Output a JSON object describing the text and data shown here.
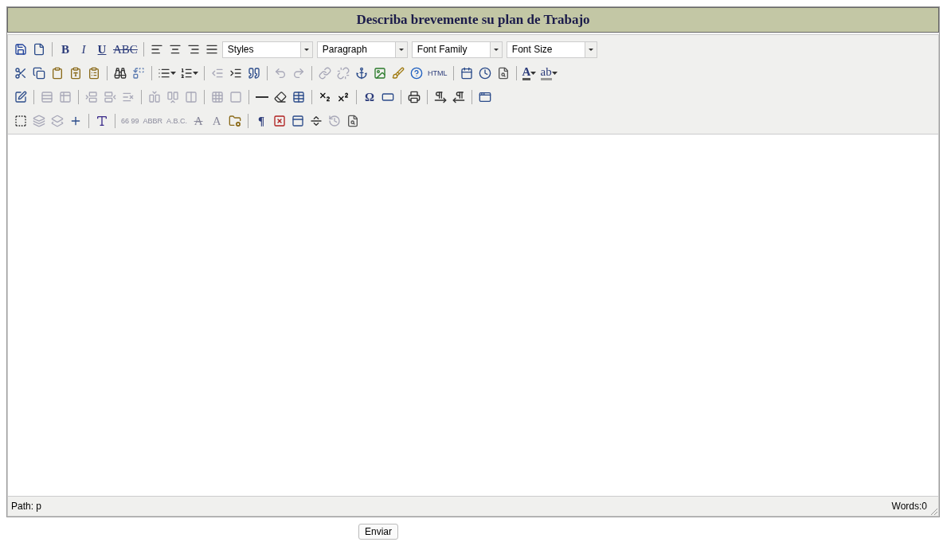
{
  "header": {
    "title": "Describa brevemente su plan de Trabajo"
  },
  "toolbar_rows": [
    [
      {
        "kind": "save",
        "disabled": false
      },
      {
        "kind": "newdoc",
        "disabled": false
      },
      {
        "kind": "separator"
      },
      {
        "kind": "bold",
        "text": "B",
        "disabled": false
      },
      {
        "kind": "italic",
        "text": "I",
        "disabled": false
      },
      {
        "kind": "underline",
        "text": "U",
        "disabled": false
      },
      {
        "kind": "strike",
        "text": "ABC",
        "disabled": false
      },
      {
        "kind": "separator"
      },
      {
        "kind": "alignleft",
        "disabled": false
      },
      {
        "kind": "aligncenter",
        "disabled": false
      },
      {
        "kind": "alignright",
        "disabled": false
      },
      {
        "kind": "alignjustify",
        "disabled": false
      },
      {
        "kind": "select",
        "label": "Styles"
      },
      {
        "kind": "select",
        "label": "Paragraph"
      },
      {
        "kind": "select",
        "label": "Font Family"
      },
      {
        "kind": "select",
        "label": "Font Size"
      }
    ],
    [
      {
        "kind": "cut",
        "disabled": false
      },
      {
        "kind": "copy",
        "disabled": false
      },
      {
        "kind": "paste",
        "disabled": false
      },
      {
        "kind": "pastetext",
        "disabled": false
      },
      {
        "kind": "pasteword",
        "disabled": false
      },
      {
        "kind": "separator"
      },
      {
        "kind": "find",
        "disabled": false
      },
      {
        "kind": "replace",
        "disabled": false
      },
      {
        "kind": "separator"
      },
      {
        "kind": "bullets",
        "disabled": false,
        "dropdown": true
      },
      {
        "kind": "numbers",
        "disabled": false,
        "dropdown": true
      },
      {
        "kind": "separator"
      },
      {
        "kind": "outdent",
        "disabled": true
      },
      {
        "kind": "indent",
        "disabled": false
      },
      {
        "kind": "quote",
        "disabled": false
      },
      {
        "kind": "separator"
      },
      {
        "kind": "undo",
        "disabled": true
      },
      {
        "kind": "redo",
        "disabled": true
      },
      {
        "kind": "separator"
      },
      {
        "kind": "link",
        "disabled": true
      },
      {
        "kind": "unlink",
        "disabled": true
      },
      {
        "kind": "anchor",
        "disabled": false
      },
      {
        "kind": "image",
        "disabled": false
      },
      {
        "kind": "cleanup",
        "disabled": false
      },
      {
        "kind": "help",
        "disabled": false
      },
      {
        "kind": "tinytext",
        "text": "HTML",
        "disabled": false
      },
      {
        "kind": "separator"
      },
      {
        "kind": "date",
        "disabled": false
      },
      {
        "kind": "time",
        "disabled": false
      },
      {
        "kind": "preview",
        "disabled": false
      },
      {
        "kind": "separator"
      },
      {
        "kind": "forecolor",
        "text": "A",
        "disabled": false,
        "dropdown": true
      },
      {
        "kind": "backcolor",
        "text": "ab",
        "disabled": false,
        "dropdown": true
      }
    ],
    [
      {
        "kind": "edit",
        "disabled": false
      },
      {
        "kind": "separator"
      },
      {
        "kind": "rowprops",
        "disabled": true
      },
      {
        "kind": "cellprops",
        "disabled": true
      },
      {
        "kind": "separator"
      },
      {
        "kind": "rowbefore",
        "disabled": true
      },
      {
        "kind": "rowafter",
        "disabled": true
      },
      {
        "kind": "rowdelete",
        "disabled": true
      },
      {
        "kind": "separator"
      },
      {
        "kind": "colbefore",
        "disabled": true
      },
      {
        "kind": "colafter",
        "disabled": true
      },
      {
        "kind": "coldelete",
        "disabled": true
      },
      {
        "kind": "separator"
      },
      {
        "kind": "splitcells",
        "disabled": true
      },
      {
        "kind": "mergecells",
        "disabled": true
      },
      {
        "kind": "separator"
      },
      {
        "kind": "hr",
        "disabled": false
      },
      {
        "kind": "eraser",
        "disabled": false
      },
      {
        "kind": "table",
        "disabled": false
      },
      {
        "kind": "separator"
      },
      {
        "kind": "subscript",
        "disabled": false
      },
      {
        "kind": "superscript",
        "disabled": false
      },
      {
        "kind": "separator"
      },
      {
        "kind": "bold",
        "text": "Ω",
        "disabled": false
      },
      {
        "kind": "hline",
        "disabled": false
      },
      {
        "kind": "separator"
      },
      {
        "kind": "print",
        "disabled": false
      },
      {
        "kind": "separator"
      },
      {
        "kind": "ltr",
        "disabled": false
      },
      {
        "kind": "rtl",
        "disabled": false
      },
      {
        "kind": "separator"
      },
      {
        "kind": "fullscreen",
        "disabled": false
      }
    ],
    [
      {
        "kind": "selectbox",
        "disabled": false
      },
      {
        "kind": "layerback",
        "disabled": true
      },
      {
        "kind": "layerforward",
        "disabled": true
      },
      {
        "kind": "insertlayer",
        "disabled": false
      },
      {
        "kind": "separator"
      },
      {
        "kind": "styleprops",
        "disabled": false
      },
      {
        "kind": "separator"
      },
      {
        "kind": "tinytext",
        "text": "66 99",
        "disabled": true
      },
      {
        "kind": "tinytext",
        "text": "ABBR",
        "disabled": true
      },
      {
        "kind": "tinytext",
        "text": "A.B.C.",
        "disabled": true
      },
      {
        "kind": "strike",
        "text": "A",
        "disabled": true
      },
      {
        "kind": "plain",
        "text": "A",
        "disabled": true
      },
      {
        "kind": "attributes",
        "disabled": false
      },
      {
        "kind": "separator"
      },
      {
        "kind": "bold",
        "text": "¶",
        "disabled": false
      },
      {
        "kind": "nonbreaking",
        "disabled": false
      },
      {
        "kind": "template",
        "disabled": false
      },
      {
        "kind": "pagebreak",
        "disabled": false
      },
      {
        "kind": "restore",
        "disabled": true
      },
      {
        "kind": "preview",
        "disabled": false
      }
    ]
  ],
  "status_bar": {
    "path": "Path: p",
    "words": "Words:0"
  },
  "submit": {
    "label": "Enviar"
  }
}
